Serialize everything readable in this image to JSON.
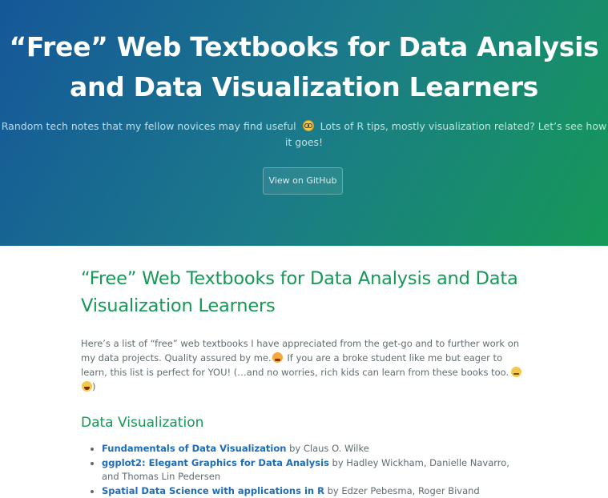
{
  "header": {
    "title_line1": "“Free” Web Textbooks for Data Analysis",
    "title_line2": "and Data Visualization Learners",
    "tagline_part1": "Random tech notes that my fellow novices may find useful",
    "tagline_part2": "Lots of R tips, mostly visualization related? Let’s see how",
    "tagline_part3": "it goes!",
    "github_button": "View on GitHub",
    "gradient_colors": [
      "#155799",
      "#159957"
    ]
  },
  "main": {
    "title_line1": "“Free” Web Textbooks for Data Analysis and Data",
    "title_line2": "Visualization Learners",
    "intro_part1": "Here’s a list of “free” web textbooks I have appreciated from the get-go and to further work on my data projects. Quality assured by me.",
    "intro_part2": "If you are a broke student like me but eager to learn, this list is perfect for YOU! (…and no worries, rich kids can learn from these books too.",
    "intro_part3": ")",
    "heading_color": "#159957",
    "link_color": "#1e6bb8",
    "sections": [
      {
        "heading": "Data Visualization",
        "books": [
          {
            "title": "Fundamentals of Data Visualization",
            "authors": "by Claus O. Wilke"
          },
          {
            "title": "ggplot2: Elegant Graphics for Data Analysis",
            "authors": "by Hadley Wickham, Danielle Navarro, and Thomas Lin Pedersen"
          },
          {
            "title": "Spatial Data Science with applications in R",
            "authors": "by Edzer Pebesma, Roger Bivand"
          }
        ]
      }
    ],
    "emoji_icons": [
      "nerd-face-icon",
      "crying-face-icon",
      "winking-face-icon",
      "laughing-face-icon"
    ]
  }
}
